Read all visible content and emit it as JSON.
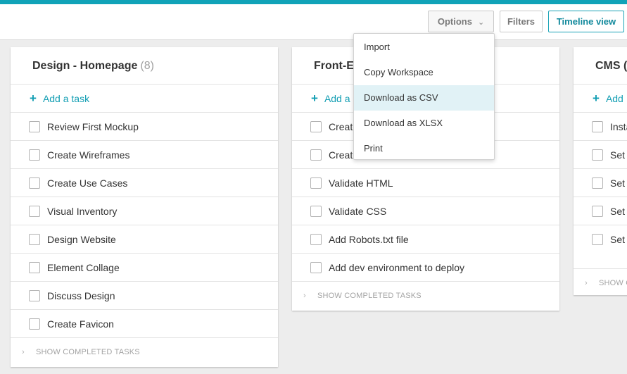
{
  "toolbar": {
    "options_label": "Options",
    "filters_label": "Filters",
    "timeline_label": "Timeline view"
  },
  "colors": {
    "accent": "#11a3b8",
    "highlight": "#e1f2f6"
  },
  "columns": [
    {
      "title": "Design - Homepage",
      "count": "(8)",
      "add_task": "Add a task",
      "tasks": [
        "Review First Mockup",
        "Create Wireframes",
        "Create Use Cases",
        "Visual Inventory",
        "Design Website",
        "Element Collage",
        "Discuss Design",
        "Create Favicon"
      ],
      "show_completed": "SHOW COMPLETED TASKS"
    },
    {
      "title": "Front-E",
      "add_task": "Add a",
      "tasks": [
        "Create",
        "Create",
        "Validate HTML",
        "Validate CSS",
        "Add Robots.txt file",
        "Add dev environment to deploy"
      ],
      "show_completed": "SHOW COMPLETED TASKS"
    },
    {
      "title": "CMS (",
      "add_task": "Add",
      "tasks": [
        "Insta",
        "Set",
        "Set",
        "Set",
        "Set char"
      ],
      "show_completed": "SHOW C"
    }
  ],
  "options_menu": {
    "items": [
      "Import",
      "Copy Workspace",
      "Download as CSV",
      "Download as XLSX",
      "Print"
    ],
    "highlighted": "Download as CSV"
  }
}
